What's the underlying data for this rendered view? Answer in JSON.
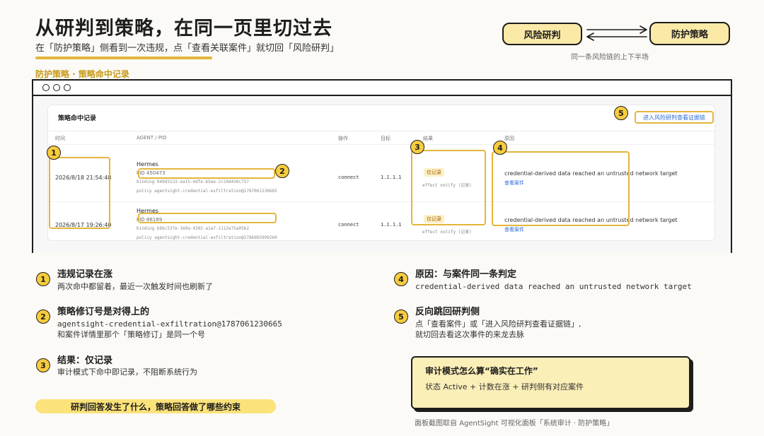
{
  "header": {
    "title": "从研判到策略，在同一页里切过去",
    "subtitle": "在「防护策略」侧看到一次违规，点「查看关联案件」就切回「风险研判」",
    "section_label": "防护策略 · 策略命中记录"
  },
  "flow": {
    "left_label": "风险研判",
    "right_label": "防护策略",
    "caption": "同一条风险链的上下半场"
  },
  "panel": {
    "title": "策略命中记录",
    "evidence_link": "进入风险研判查看证据链",
    "columns": [
      "时间",
      "AGENT / PID",
      "操作",
      "目标",
      "结果",
      "原因"
    ],
    "rows": [
      {
        "time": "2026/8/18 21:54:48",
        "agent": "Hermes",
        "pid": "PID 450473",
        "binding": "binding 049d3133-ea15-4dfe-b5ee-2c19d420c757",
        "policy": "policy agentsight-credential-exfiltration@1787061230665",
        "op": "connect",
        "target": "1.1.1.1",
        "result_badge": "仅记录",
        "effect": "effect notify (记录)",
        "reason": "credential-derived data reached an untrusted network target",
        "case_link": "查看案件"
      },
      {
        "time": "2026/8/17 19:26:40",
        "agent": "Hermes",
        "pid": "PID 86189",
        "binding": "binding bbbc537e-160a-4392-a1a7-1112e75a05b2",
        "policy": "policy agentsight-credential-exfiltration@1786965999260",
        "op": "connect",
        "target": "1.1.1.1",
        "result_badge": "仅记录",
        "effect": "effect notify (记录)",
        "reason": "credential-derived data reached an untrusted network target",
        "case_link": "查看案件"
      }
    ]
  },
  "markers": [
    "1",
    "2",
    "3",
    "4",
    "5"
  ],
  "notes": [
    {
      "num": "1",
      "title": "违规记录在涨",
      "body1": "两次命中都留着，最近一次触发时间也刷新了"
    },
    {
      "num": "2",
      "title": "策略修订号是对得上的",
      "body1": "agentsight-credential-exfiltration@1787061230665",
      "body2": "和案件详情里那个「策略修订」是同一个号"
    },
    {
      "num": "3",
      "title": "结果：仅记录",
      "body1": "审计模式下命中即记录，不阻断系统行为"
    },
    {
      "num": "4",
      "title": "原因：与案件同一条判定",
      "body1": "credential-derived data reached an untrusted network target"
    },
    {
      "num": "5",
      "title": "反向跳回研判侧",
      "body1": "点「查看案件」或「进入风险研判查看证据链」,",
      "body2": "就切回去看这次事件的来龙去脉"
    }
  ],
  "banner": "研判回答发生了什么，策略回答做了哪些约束",
  "audit": {
    "title": "审计模式怎么算“确实在工作”",
    "body": "状态 Active + 计数在涨 + 研判侧有对应案件"
  },
  "source_caption": "面板截图取自 AgentSight 可视化面板「系统审计 · 防护策略」",
  "colors": {
    "accent": "#e3b53b",
    "marker": "#f6cb3e",
    "link": "#2d6bd8",
    "card": "#fbefb8"
  }
}
